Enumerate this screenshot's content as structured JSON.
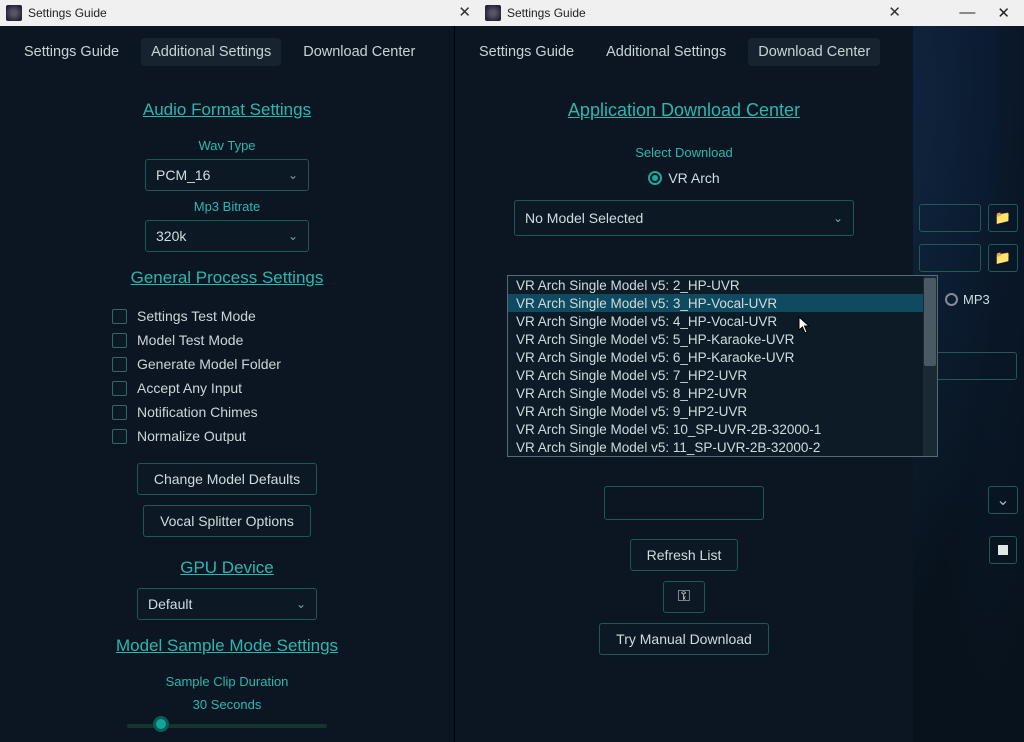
{
  "titlebar": {
    "title": "Settings Guide"
  },
  "tabs": {
    "guide": "Settings Guide",
    "additional": "Additional Settings",
    "download": "Download Center"
  },
  "left": {
    "audio_title": "Audio Format Settings",
    "wav_type_label": "Wav Type",
    "wav_type_value": "PCM_16",
    "mp3_label": "Mp3 Bitrate",
    "mp3_value": "320k",
    "general_title": "General Process Settings",
    "checks": {
      "test_mode": "Settings Test Mode",
      "model_test": "Model Test Mode",
      "gen_folder": "Generate Model Folder",
      "accept_any": "Accept Any Input",
      "chimes": "Notification Chimes",
      "normalize": "Normalize Output"
    },
    "btn_change_defaults": "Change Model Defaults",
    "btn_vocal_splitter": "Vocal Splitter Options",
    "gpu_title": "GPU Device",
    "gpu_value": "Default",
    "sample_title": "Model Sample Mode Settings",
    "sample_label": "Sample Clip Duration",
    "sample_value": "30 Seconds"
  },
  "right": {
    "title": "Application Download Center",
    "select_dl": "Select Download",
    "vr_arch": "VR Arch",
    "model_select": "No Model Selected",
    "refresh": "Refresh List",
    "manual": "Try Manual Download",
    "dropdown": [
      "VR Arch Single Model v5: 2_HP-UVR",
      "VR Arch Single Model v5: 3_HP-Vocal-UVR",
      "VR Arch Single Model v5: 4_HP-Vocal-UVR",
      "VR Arch Single Model v5: 5_HP-Karaoke-UVR",
      "VR Arch Single Model v5: 6_HP-Karaoke-UVR",
      "VR Arch Single Model v5: 7_HP2-UVR",
      "VR Arch Single Model v5: 8_HP2-UVR",
      "VR Arch Single Model v5: 9_HP2-UVR",
      "VR Arch Single Model v5: 10_SP-UVR-2B-32000-1",
      "VR Arch Single Model v5: 11_SP-UVR-2B-32000-2"
    ]
  },
  "main_under": {
    "mp3": "MP3"
  }
}
